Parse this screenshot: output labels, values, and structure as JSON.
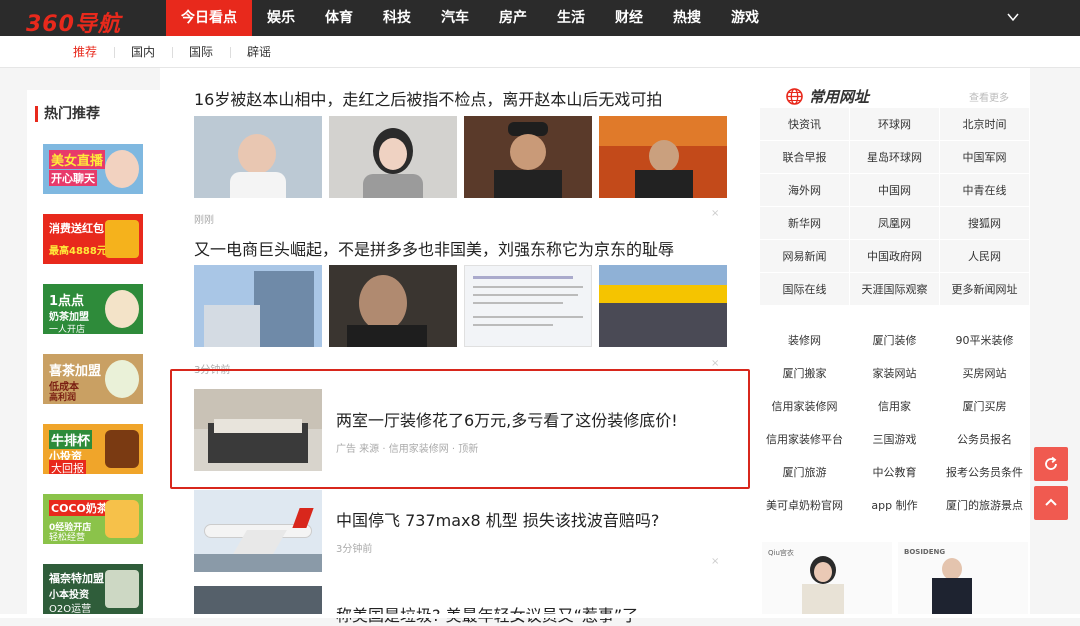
{
  "topbar": {
    "logo": "360导航",
    "nav": [
      "今日看点",
      "娱乐",
      "体育",
      "科技",
      "汽车",
      "房产",
      "生活",
      "财经",
      "热搜",
      "游戏"
    ]
  },
  "subnav": [
    "推荐",
    "国内",
    "国际",
    "辟谣"
  ],
  "sidebar": {
    "title": "热门推荐",
    "ads": [
      {
        "t1": "美女直播",
        "t2": "开心聊天",
        "t3": "",
        "bg": "#7fb8e0"
      },
      {
        "t1": "消费送红包",
        "t2": "最高4888元",
        "t3": "",
        "bg": "#e8291c"
      },
      {
        "t1": "1点点",
        "t2": "奶茶加盟",
        "t3": "一人开店",
        "bg": "#2e8b3a"
      },
      {
        "t1": "喜茶加盟",
        "t2": "低成本",
        "t3": "高利润",
        "bg": "#b88a3a"
      },
      {
        "t1": "牛排杯",
        "t2": "小投资",
        "t3": "大回报",
        "bg": "#e89b1c"
      },
      {
        "t1": "COCO奶茶",
        "t2": "0经验开店",
        "t3": "轻松经营",
        "bg": "#8bc34a"
      },
      {
        "t1": "福奈特加盟",
        "t2": "小本投资",
        "t3": "O2O运营",
        "bg": "#2f5d3a"
      }
    ]
  },
  "news": {
    "item1": {
      "title": "16岁被赵本山相中，走红之后被指不检点，离开赵本山后无戏可拍",
      "meta": "刚刚"
    },
    "item2": {
      "title": "又一电商巨头崛起，不是拼多多也非国美，刘强东称它为京东的耻辱",
      "meta": "3分钟前"
    },
    "item3": {
      "title": "两室一厅装修花了6万元,多亏看了这份装修底价!",
      "meta": "广告  来源 · 信用家装修网 · 顶新"
    },
    "item4": {
      "title": "中国停飞 737max8 机型 损失该找波音赔吗?",
      "meta": "3分钟前"
    },
    "item5": {
      "title": "称美国是垃圾? 美最年轻女议员又“惹事”了"
    },
    "close": "×"
  },
  "right": {
    "title": "常用网址",
    "more": "查看更多",
    "links_a": [
      "快资讯",
      "环球网",
      "北京时间",
      "联合早报",
      "星岛环球网",
      "中国军网",
      "海外网",
      "中国网",
      "中青在线",
      "新华网",
      "凤凰网",
      "搜狐网",
      "网易新闻",
      "中国政府网",
      "人民网",
      "国际在线",
      "天涯国际观察",
      "更多新闻网址"
    ],
    "links_b": [
      "装修网",
      "厦门装修",
      "90平米装修",
      "厦门搬家",
      "家装网站",
      "买房网站",
      "信用家装修网",
      "信用家",
      "厦门买房",
      "信用家装修平台",
      "三国游戏",
      "公务员报名",
      "厦门旅游",
      "中公教育",
      "报考公务员条件",
      "美可卓奶粉官网",
      "app 制作",
      "厦门的旅游景点"
    ],
    "product_labels": [
      "Qiu宫衣",
      "BOSIDENG"
    ]
  },
  "colors": {
    "brand": "#e8291c",
    "topbar": "#2b2b2b"
  }
}
